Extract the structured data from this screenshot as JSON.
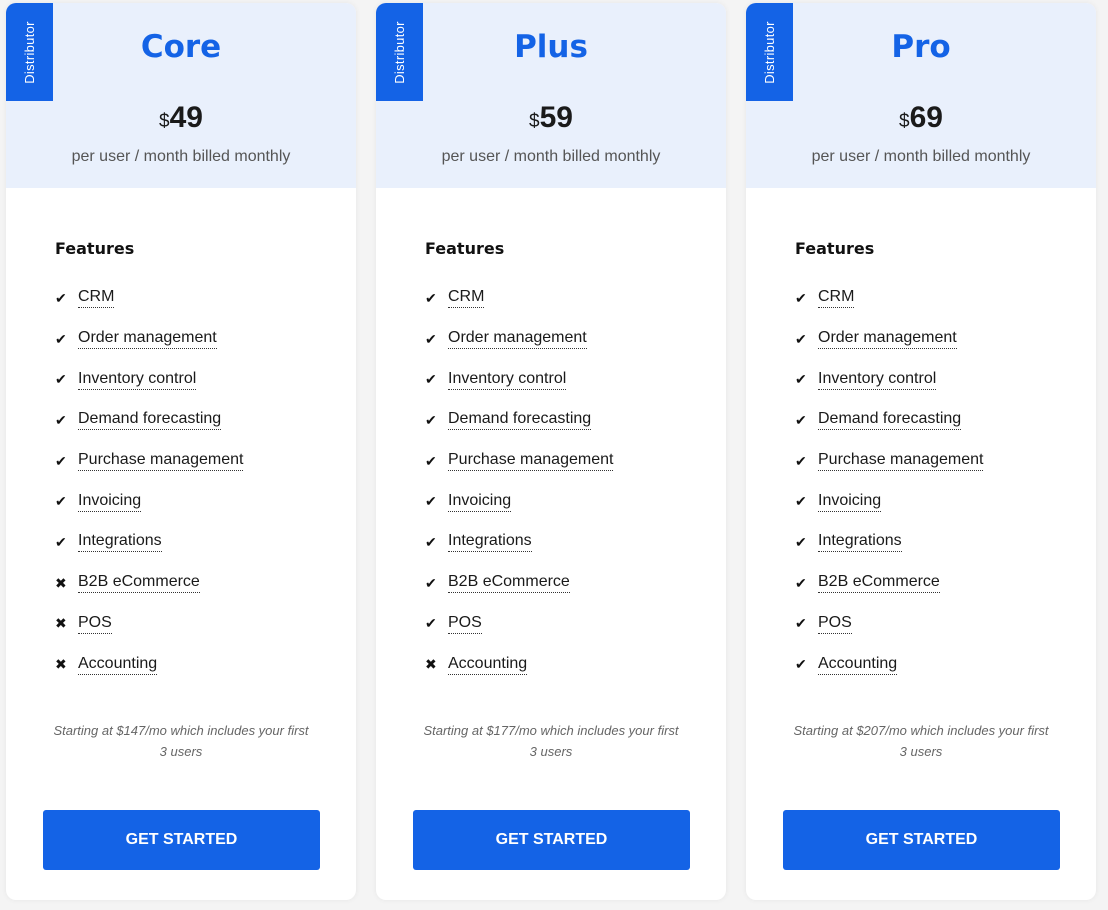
{
  "plans": [
    {
      "badge": "Distributor",
      "name": "Core",
      "currency": "$",
      "price": "49",
      "billing": "per user / month billed monthly",
      "features_title": "Features",
      "features": [
        {
          "label": "CRM",
          "included": true
        },
        {
          "label": "Order management",
          "included": true
        },
        {
          "label": "Inventory control",
          "included": true
        },
        {
          "label": "Demand forecasting",
          "included": true
        },
        {
          "label": "Purchase management",
          "included": true
        },
        {
          "label": "Invoicing",
          "included": true
        },
        {
          "label": "Integrations",
          "included": true
        },
        {
          "label": "B2B eCommerce",
          "included": false
        },
        {
          "label": "POS",
          "included": false
        },
        {
          "label": "Accounting",
          "included": false
        }
      ],
      "note": "Starting at $147/mo which includes your first 3 users",
      "cta": "GET STARTED"
    },
    {
      "badge": "Distributor",
      "name": "Plus",
      "currency": "$",
      "price": "59",
      "billing": "per user / month billed monthly",
      "features_title": "Features",
      "features": [
        {
          "label": "CRM",
          "included": true
        },
        {
          "label": "Order management",
          "included": true
        },
        {
          "label": "Inventory control",
          "included": true
        },
        {
          "label": "Demand forecasting",
          "included": true
        },
        {
          "label": "Purchase management",
          "included": true
        },
        {
          "label": "Invoicing",
          "included": true
        },
        {
          "label": "Integrations",
          "included": true
        },
        {
          "label": "B2B eCommerce",
          "included": true
        },
        {
          "label": "POS",
          "included": true
        },
        {
          "label": "Accounting",
          "included": false
        }
      ],
      "note": "Starting at $177/mo which includes your first 3 users",
      "cta": "GET STARTED"
    },
    {
      "badge": "Distributor",
      "name": "Pro",
      "currency": "$",
      "price": "69",
      "billing": "per user / month billed monthly",
      "features_title": "Features",
      "features": [
        {
          "label": "CRM",
          "included": true
        },
        {
          "label": "Order management",
          "included": true
        },
        {
          "label": "Inventory control",
          "included": true
        },
        {
          "label": "Demand forecasting",
          "included": true
        },
        {
          "label": "Purchase management",
          "included": true
        },
        {
          "label": "Invoicing",
          "included": true
        },
        {
          "label": "Integrations",
          "included": true
        },
        {
          "label": "B2B eCommerce",
          "included": true
        },
        {
          "label": "POS",
          "included": true
        },
        {
          "label": "Accounting",
          "included": true
        }
      ],
      "note": "Starting at $207/mo which includes your first 3 users",
      "cta": "GET STARTED"
    }
  ],
  "icons": {
    "included": "✔",
    "excluded": "✖"
  },
  "colors": {
    "accent": "#1463e6",
    "header_bg": "#e9f0fc"
  }
}
